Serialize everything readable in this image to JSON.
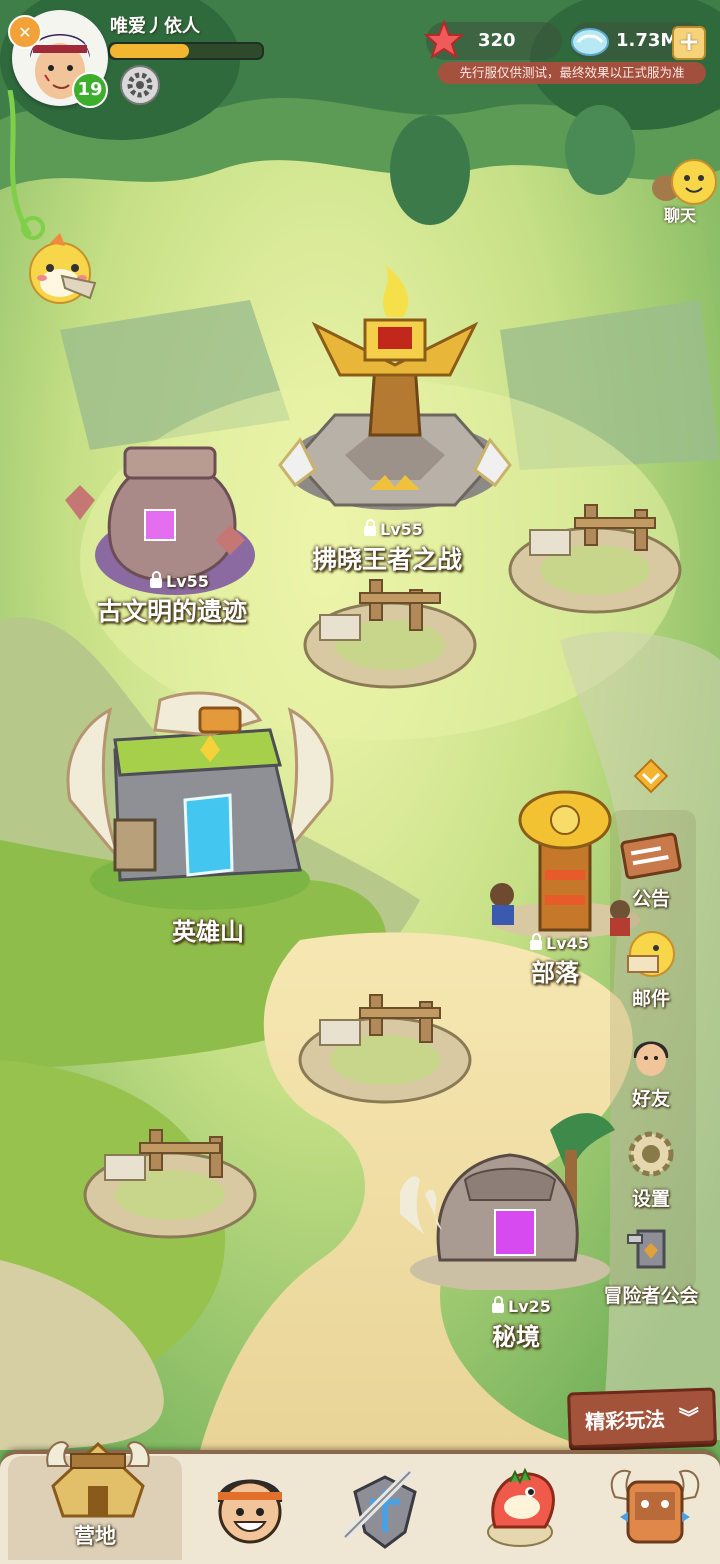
{
  "player": {
    "name": "唯爱丿依人",
    "level": "19",
    "xp_progress": 0.52
  },
  "currency": {
    "starfish_amount": "320",
    "gem_amount": "1.73M",
    "disclaimer": "先行服仅供测试，最终效果以正式服为准"
  },
  "chat": {
    "label": "聊天"
  },
  "locations": {
    "dawn_king": {
      "name": "拂晓王者之战",
      "level": "Lv55"
    },
    "ancient_ruins": {
      "name": "古文明的遗迹",
      "level": "Lv55"
    },
    "hero_mountain": {
      "name": "英雄山"
    },
    "tribe": {
      "name": "部落",
      "level": "Lv45"
    },
    "secret_realm": {
      "name": "秘境",
      "level": "Lv25"
    }
  },
  "side_menu": {
    "notice": "公告",
    "mail": "邮件",
    "friends": "好友",
    "settings": "设置",
    "guild": "冒险者公会"
  },
  "highlights_button": "精彩玩法",
  "bottom_nav": {
    "camp": "营地"
  },
  "colors": {
    "accent_gold": "#f2b630",
    "disclaimer_bg": "#b64a3e",
    "level_badge": "#3cae2c"
  }
}
